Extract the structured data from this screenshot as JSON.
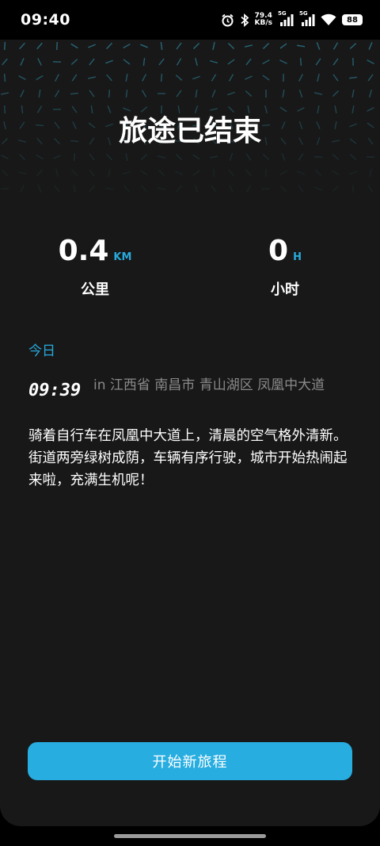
{
  "status_bar": {
    "time": "09:40",
    "speed_value": "79.4",
    "speed_unit": "KB/s",
    "sim1_label": "5G",
    "sim2_label": "5G",
    "battery": "88",
    "icons": [
      "alarm-icon",
      "bluetooth-icon",
      "signal-icon",
      "signal-icon",
      "wifi-icon",
      "battery-icon"
    ]
  },
  "header": {
    "title": "旅途已结束"
  },
  "stats": {
    "distance": {
      "value": "0.4",
      "unit": "KM",
      "label": "公里"
    },
    "duration": {
      "value": "0",
      "unit": "H",
      "label": "小时"
    }
  },
  "journal": {
    "section_label": "今日",
    "entries": [
      {
        "time": "09:39",
        "location": "in 江西省 南昌市 青山湖区 凤凰中大道",
        "text": "骑着自行车在凤凰中大道上，清晨的空气格外清新。街道两旁绿树成荫，车辆有序行驶，城市开始热闹起来啦，充满生机呢！"
      }
    ]
  },
  "actions": {
    "new_trip_label": "开始新旅程"
  },
  "colors": {
    "accent": "#27ade0",
    "background": "#181818",
    "pattern": "#2f8fa8"
  }
}
